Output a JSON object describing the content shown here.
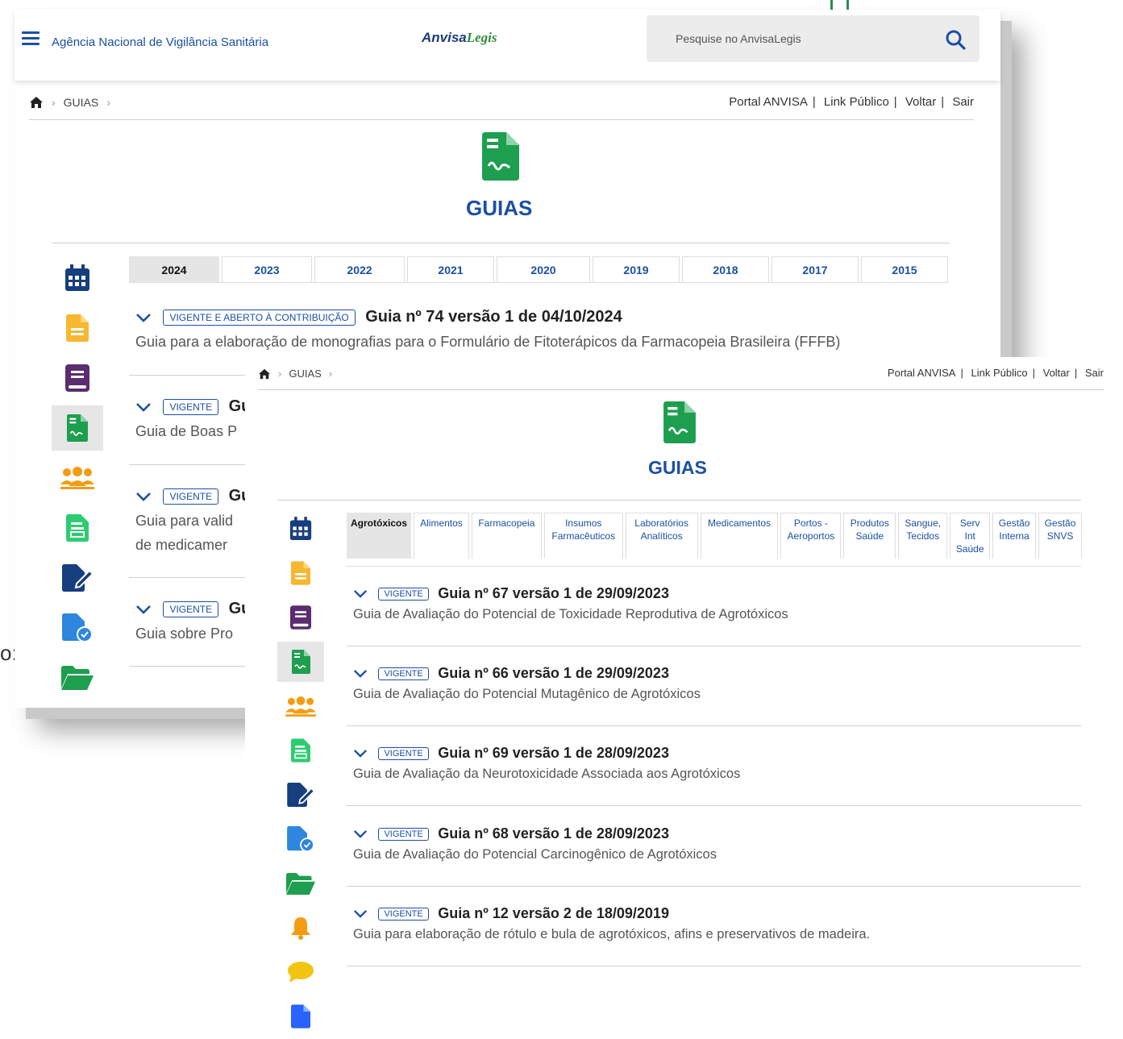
{
  "back": {
    "agency": "Agência Nacional de Vigilância Sanitária",
    "logo_part1": "Anvisa",
    "logo_part2": "Legis",
    "search_placeholder": "Pesquise no AnvisaLegis",
    "breadcrumb": "GUIAS",
    "links": [
      "Portal ANVISA",
      "Link Público",
      "Voltar",
      "Sair"
    ],
    "page_title": "GUIAS",
    "years": [
      "2024",
      "2023",
      "2022",
      "2021",
      "2020",
      "2019",
      "2018",
      "2017",
      "2015"
    ],
    "guides": [
      {
        "badge": "VIGENTE E ABERTO À CONTRIBUIÇÃO",
        "title": "Guia nº 74 versão 1 de 04/10/2024",
        "desc": "Guia para a elaboração de monografias para o Formulário de Fitoterápicos da Farmacopeia Brasileira (FFFB)"
      },
      {
        "badge": "VIGENTE",
        "title": "Gu",
        "desc": "Guia de Boas P"
      },
      {
        "badge": "VIGENTE",
        "title": "Gu",
        "desc": "Guia para valid",
        "desc2": "de medicamer"
      },
      {
        "badge": "VIGENTE",
        "title": "Gu",
        "desc": "Guia sobre Pro"
      }
    ]
  },
  "front": {
    "breadcrumb": "GUIAS",
    "links": [
      "Portal ANVISA",
      "Link Público",
      "Voltar",
      "Sair"
    ],
    "page_title": "GUIAS",
    "categories": [
      "Agrotóxicos",
      "Alimentos",
      "Farmacopeia",
      "Insumos\nFarmacêuticos",
      "Laboratórios\nAnalíticos",
      "Medicamentos",
      "Portos -\nAeroportos",
      "Produtos\nSaúde",
      "Sangue,\nTecidos",
      "Serv\nInt\nSaúde",
      "Gestão\nInterna",
      "Gestão\nSNVS"
    ],
    "guides": [
      {
        "badge": "VIGENTE",
        "title": "Guia nº 67 versão 1 de 29/09/2023",
        "desc": "Guia de Avaliação do Potencial de Toxicidade Reprodutiva de Agrotóxicos"
      },
      {
        "badge": "VIGENTE",
        "title": "Guia nº 66 versão 1 de 29/09/2023",
        "desc": "Guia de Avaliação do Potencial Mutagênico de Agrotóxicos"
      },
      {
        "badge": "VIGENTE",
        "title": "Guia nº 69 versão 1 de 28/09/2023",
        "desc": "Guia de Avaliação da Neurotoxicidade Associada aos Agrotóxicos"
      },
      {
        "badge": "VIGENTE",
        "title": "Guia nº 68 versão 1 de 28/09/2023",
        "desc": "Guia de Avaliação do Potencial Carcinogênico de Agrotóxicos"
      },
      {
        "badge": "VIGENTE",
        "title": "Guia nº 12 versão 2 de 18/09/2019",
        "desc": "Guia para elaboração de rótulo e bula de agrotóxicos, afins e preservativos de madeira."
      }
    ]
  },
  "fragment_text": "o:",
  "icons": {
    "sidebar": [
      "calendar-icon",
      "document-icon",
      "book-icon",
      "guide-doc-icon",
      "people-icon",
      "form-icon",
      "edit-file-icon",
      "approved-file-icon",
      "folder-open-icon",
      "bell-icon",
      "chat-icon",
      "file-icon"
    ]
  },
  "colors": {
    "primary": "#1b4fa5",
    "green": "#1e9e4f",
    "active_tab": "#e5e5e5"
  }
}
